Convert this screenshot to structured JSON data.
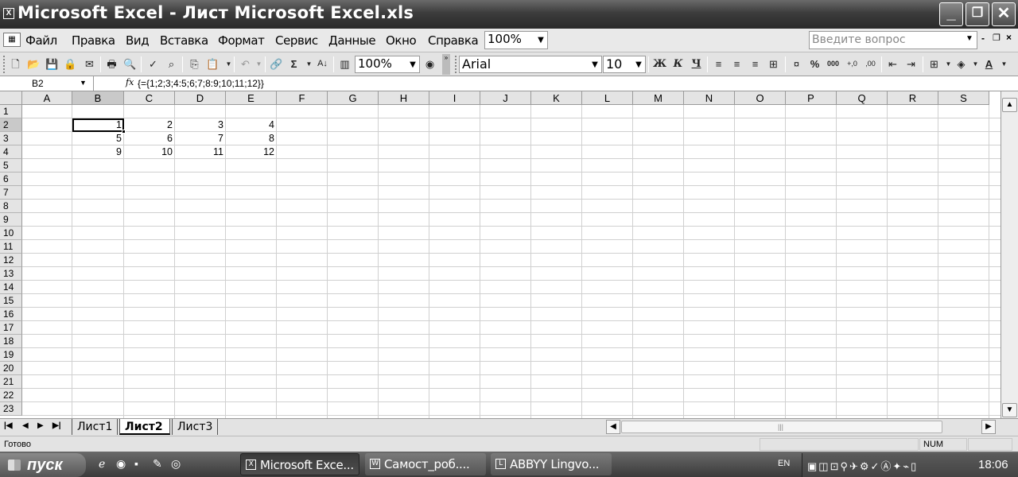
{
  "window": {
    "title": "Microsoft Excel - Лист Microsoft Excel.xls",
    "app_icon": "excel-icon",
    "buttons": [
      "minimize",
      "restore",
      "close"
    ]
  },
  "menu": {
    "items": [
      "Файл",
      "Правка",
      "Вид",
      "Вставка",
      "Формат",
      "Сервис",
      "Данные",
      "Окно",
      "Справка"
    ],
    "zoom": "100%",
    "help_placeholder": "Введите вопрос"
  },
  "toolbar": {
    "zoom": "100%",
    "font_name": "Arial",
    "font_size": "10",
    "bold_label": "Ж",
    "italic_label": "К",
    "underline_label": "Ч",
    "sum_label": "Σ",
    "percent_label": "%",
    "thousands_label": "000"
  },
  "formula_bar": {
    "name_box": "B2",
    "fx": "fx",
    "formula": "{={1;2;3;4:5;6;7;8:9;10;11;12}}"
  },
  "grid": {
    "columns": [
      "A",
      "B",
      "C",
      "D",
      "E",
      "F",
      "G",
      "H",
      "I",
      "J",
      "K",
      "L",
      "M",
      "N",
      "O",
      "P",
      "Q",
      "R",
      "S"
    ],
    "rows": [
      "1",
      "2",
      "3",
      "4",
      "5",
      "6",
      "7",
      "8",
      "9",
      "10",
      "11",
      "12",
      "13",
      "14",
      "15",
      "16",
      "17",
      "18",
      "19",
      "20",
      "21",
      "22",
      "23"
    ],
    "cells": {
      "B2": "1",
      "C2": "2",
      "D2": "3",
      "E2": "4",
      "B3": "5",
      "C3": "6",
      "D3": "7",
      "E3": "8",
      "B4": "9",
      "C4": "10",
      "D4": "11",
      "E4": "12"
    },
    "active_cell": "B2"
  },
  "sheets": {
    "tabs": [
      "Лист1",
      "Лист2",
      "Лист3"
    ],
    "active": "Лист2"
  },
  "status": {
    "ready": "Готово",
    "num": "NUM"
  },
  "taskbar": {
    "start": "пуск",
    "tasks": [
      "Microsoft Exce...",
      "Самост_роб....",
      "ABBYY Lingvo..."
    ],
    "lang": "EN",
    "clock": "18:06"
  }
}
